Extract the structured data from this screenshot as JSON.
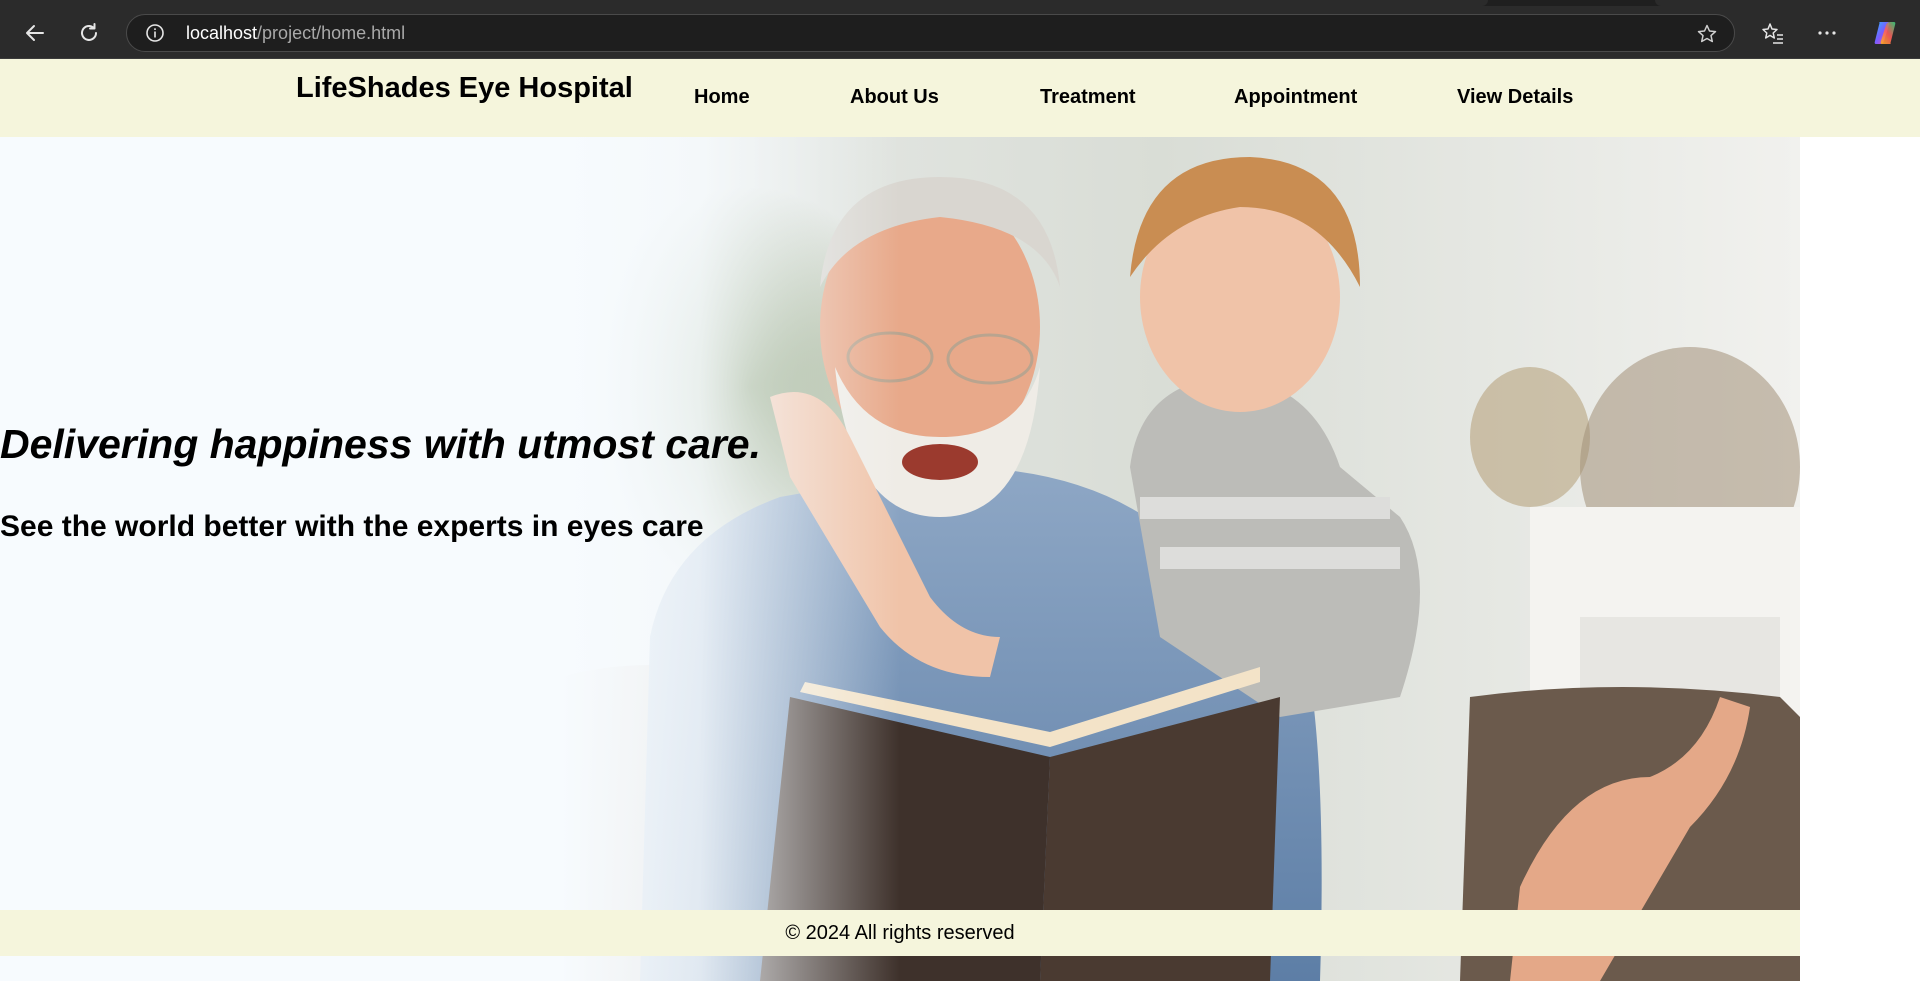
{
  "browser": {
    "url_host": "localhost",
    "url_path": "/project/home.html",
    "icons": [
      "back-icon",
      "reload-icon",
      "info-icon",
      "star-icon",
      "favorites-icon",
      "more-icon",
      "copilot-icon"
    ]
  },
  "header": {
    "brand": "LifeShades Eye Hospital",
    "nav": [
      "Home",
      "About Us",
      "Treatment",
      "Appointment",
      "View Details"
    ]
  },
  "hero": {
    "tagline": "Delivering happiness with utmost care.",
    "subline": "See the world better with the experts in eyes care",
    "image": "grandfather and child reading a book"
  },
  "footer": {
    "text": "© 2024 All rights reserved"
  },
  "colors": {
    "header_bg": "#f5f5dc",
    "footer_bg": "#f5f5dc",
    "hero_bg": "#f7fbfe",
    "chrome_bg": "#2b2b2b"
  }
}
